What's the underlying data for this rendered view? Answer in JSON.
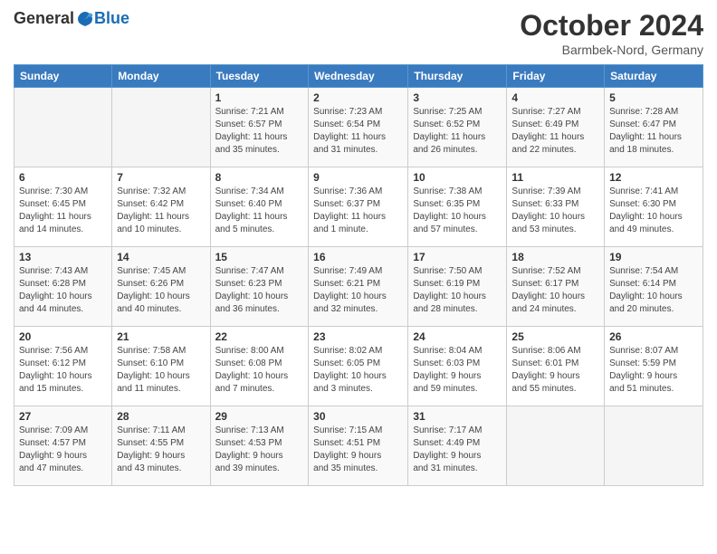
{
  "header": {
    "logo_general": "General",
    "logo_blue": "Blue",
    "month_title": "October 2024",
    "location": "Barmbek-Nord, Germany"
  },
  "calendar": {
    "days_of_week": [
      "Sunday",
      "Monday",
      "Tuesday",
      "Wednesday",
      "Thursday",
      "Friday",
      "Saturday"
    ],
    "weeks": [
      [
        {
          "day": "",
          "detail": ""
        },
        {
          "day": "",
          "detail": ""
        },
        {
          "day": "1",
          "detail": "Sunrise: 7:21 AM\nSunset: 6:57 PM\nDaylight: 11 hours\nand 35 minutes."
        },
        {
          "day": "2",
          "detail": "Sunrise: 7:23 AM\nSunset: 6:54 PM\nDaylight: 11 hours\nand 31 minutes."
        },
        {
          "day": "3",
          "detail": "Sunrise: 7:25 AM\nSunset: 6:52 PM\nDaylight: 11 hours\nand 26 minutes."
        },
        {
          "day": "4",
          "detail": "Sunrise: 7:27 AM\nSunset: 6:49 PM\nDaylight: 11 hours\nand 22 minutes."
        },
        {
          "day": "5",
          "detail": "Sunrise: 7:28 AM\nSunset: 6:47 PM\nDaylight: 11 hours\nand 18 minutes."
        }
      ],
      [
        {
          "day": "6",
          "detail": "Sunrise: 7:30 AM\nSunset: 6:45 PM\nDaylight: 11 hours\nand 14 minutes."
        },
        {
          "day": "7",
          "detail": "Sunrise: 7:32 AM\nSunset: 6:42 PM\nDaylight: 11 hours\nand 10 minutes."
        },
        {
          "day": "8",
          "detail": "Sunrise: 7:34 AM\nSunset: 6:40 PM\nDaylight: 11 hours\nand 5 minutes."
        },
        {
          "day": "9",
          "detail": "Sunrise: 7:36 AM\nSunset: 6:37 PM\nDaylight: 11 hours\nand 1 minute."
        },
        {
          "day": "10",
          "detail": "Sunrise: 7:38 AM\nSunset: 6:35 PM\nDaylight: 10 hours\nand 57 minutes."
        },
        {
          "day": "11",
          "detail": "Sunrise: 7:39 AM\nSunset: 6:33 PM\nDaylight: 10 hours\nand 53 minutes."
        },
        {
          "day": "12",
          "detail": "Sunrise: 7:41 AM\nSunset: 6:30 PM\nDaylight: 10 hours\nand 49 minutes."
        }
      ],
      [
        {
          "day": "13",
          "detail": "Sunrise: 7:43 AM\nSunset: 6:28 PM\nDaylight: 10 hours\nand 44 minutes."
        },
        {
          "day": "14",
          "detail": "Sunrise: 7:45 AM\nSunset: 6:26 PM\nDaylight: 10 hours\nand 40 minutes."
        },
        {
          "day": "15",
          "detail": "Sunrise: 7:47 AM\nSunset: 6:23 PM\nDaylight: 10 hours\nand 36 minutes."
        },
        {
          "day": "16",
          "detail": "Sunrise: 7:49 AM\nSunset: 6:21 PM\nDaylight: 10 hours\nand 32 minutes."
        },
        {
          "day": "17",
          "detail": "Sunrise: 7:50 AM\nSunset: 6:19 PM\nDaylight: 10 hours\nand 28 minutes."
        },
        {
          "day": "18",
          "detail": "Sunrise: 7:52 AM\nSunset: 6:17 PM\nDaylight: 10 hours\nand 24 minutes."
        },
        {
          "day": "19",
          "detail": "Sunrise: 7:54 AM\nSunset: 6:14 PM\nDaylight: 10 hours\nand 20 minutes."
        }
      ],
      [
        {
          "day": "20",
          "detail": "Sunrise: 7:56 AM\nSunset: 6:12 PM\nDaylight: 10 hours\nand 15 minutes."
        },
        {
          "day": "21",
          "detail": "Sunrise: 7:58 AM\nSunset: 6:10 PM\nDaylight: 10 hours\nand 11 minutes."
        },
        {
          "day": "22",
          "detail": "Sunrise: 8:00 AM\nSunset: 6:08 PM\nDaylight: 10 hours\nand 7 minutes."
        },
        {
          "day": "23",
          "detail": "Sunrise: 8:02 AM\nSunset: 6:05 PM\nDaylight: 10 hours\nand 3 minutes."
        },
        {
          "day": "24",
          "detail": "Sunrise: 8:04 AM\nSunset: 6:03 PM\nDaylight: 9 hours\nand 59 minutes."
        },
        {
          "day": "25",
          "detail": "Sunrise: 8:06 AM\nSunset: 6:01 PM\nDaylight: 9 hours\nand 55 minutes."
        },
        {
          "day": "26",
          "detail": "Sunrise: 8:07 AM\nSunset: 5:59 PM\nDaylight: 9 hours\nand 51 minutes."
        }
      ],
      [
        {
          "day": "27",
          "detail": "Sunrise: 7:09 AM\nSunset: 4:57 PM\nDaylight: 9 hours\nand 47 minutes."
        },
        {
          "day": "28",
          "detail": "Sunrise: 7:11 AM\nSunset: 4:55 PM\nDaylight: 9 hours\nand 43 minutes."
        },
        {
          "day": "29",
          "detail": "Sunrise: 7:13 AM\nSunset: 4:53 PM\nDaylight: 9 hours\nand 39 minutes."
        },
        {
          "day": "30",
          "detail": "Sunrise: 7:15 AM\nSunset: 4:51 PM\nDaylight: 9 hours\nand 35 minutes."
        },
        {
          "day": "31",
          "detail": "Sunrise: 7:17 AM\nSunset: 4:49 PM\nDaylight: 9 hours\nand 31 minutes."
        },
        {
          "day": "",
          "detail": ""
        },
        {
          "day": "",
          "detail": ""
        }
      ]
    ]
  }
}
